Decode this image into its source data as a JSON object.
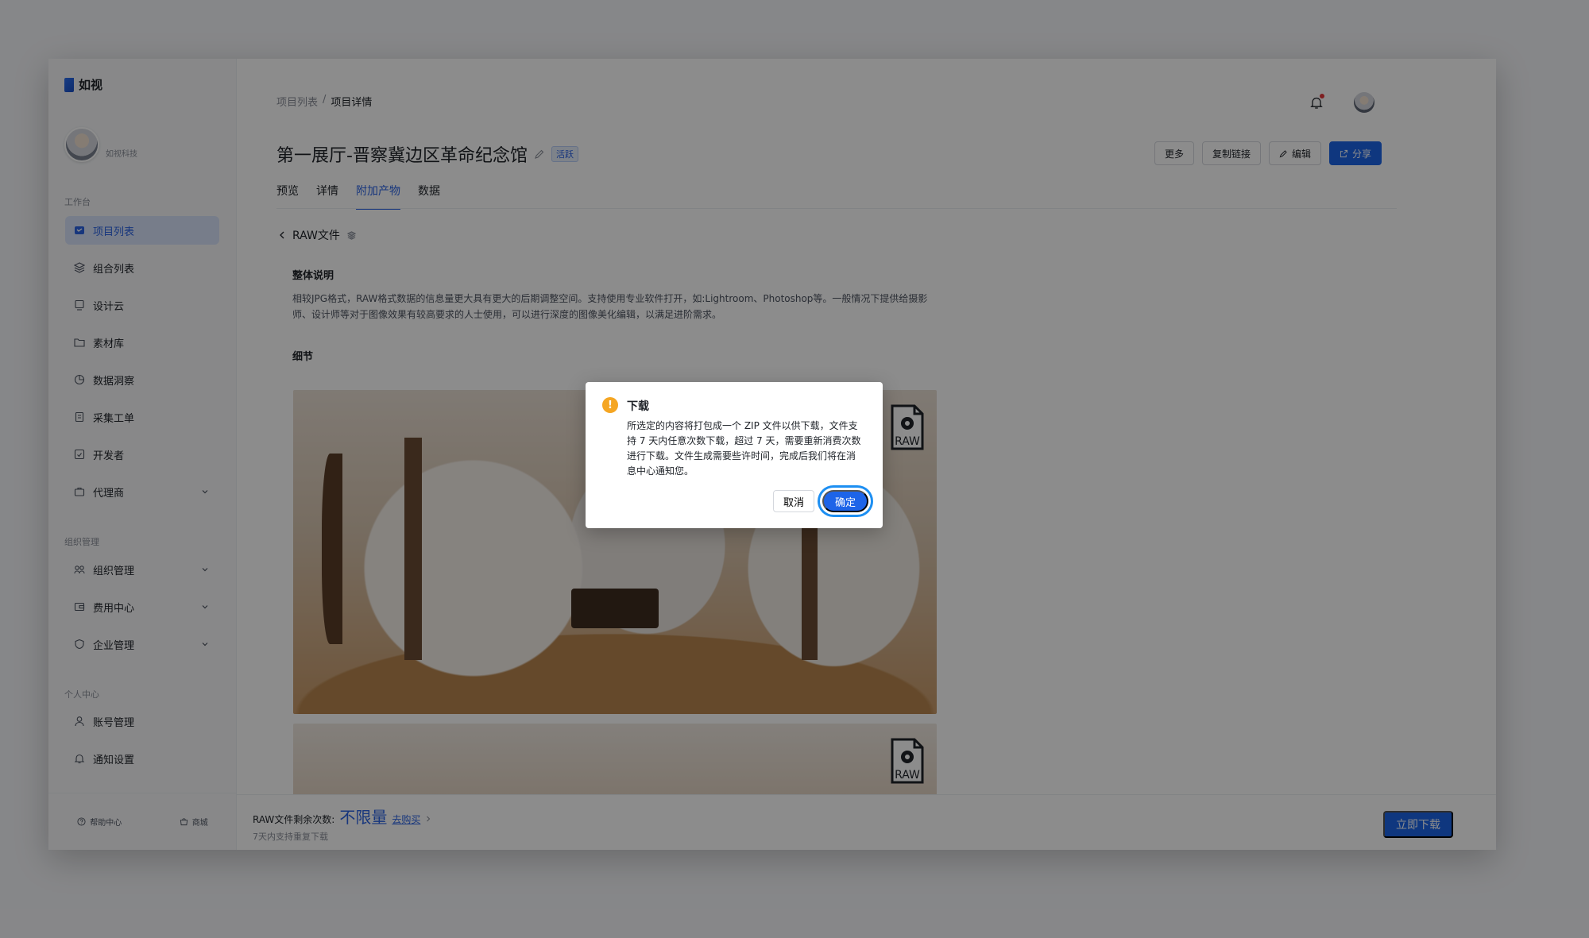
{
  "app": {
    "name": "如视",
    "user_name": "如视科技"
  },
  "sidebar": {
    "section_workbench": "工作台",
    "section_org": "组织管理",
    "section_personal": "个人中心",
    "workbench_items": [
      {
        "label": "项目列表",
        "icon": "projects-icon"
      },
      {
        "label": "组合列表",
        "icon": "layers-icon"
      },
      {
        "label": "设计云",
        "icon": "design-icon"
      },
      {
        "label": "素材库",
        "icon": "folder-icon"
      },
      {
        "label": "数据洞察",
        "icon": "chart-icon"
      },
      {
        "label": "采集工单",
        "icon": "ticket-icon"
      },
      {
        "label": "开发者",
        "icon": "code-icon"
      },
      {
        "label": "代理商",
        "icon": "briefcase-icon"
      }
    ],
    "org_items": [
      {
        "label": "组织管理",
        "icon": "org-icon"
      },
      {
        "label": "费用中心",
        "icon": "wallet-icon"
      },
      {
        "label": "企业管理",
        "icon": "shield-icon"
      }
    ],
    "personal_items": [
      {
        "label": "账号管理",
        "icon": "user-icon"
      },
      {
        "label": "通知设置",
        "icon": "bell-icon"
      }
    ],
    "footer": {
      "help": "帮助中心",
      "store": "商城"
    }
  },
  "header": {
    "breadcrumb": [
      "项目列表",
      "/",
      "项目详情"
    ],
    "title": "第一展厅-晋察冀边区革命纪念馆",
    "tag": "活跃",
    "actions": {
      "more": "更多",
      "copy_link": "复制链接",
      "edit": "编辑",
      "share": "分享"
    }
  },
  "tabs": [
    "预览",
    "详情",
    "附加产物",
    "数据"
  ],
  "content": {
    "back_label": "RAW文件",
    "overall_heading": "整体说明",
    "overall_text": "相较JPG格式，RAW格式数据的信息量更大具有更大的后期调整空间。支持使用专业软件打开，如:Lightroom、Photoshop等。一般情况下提供给摄影师、设计师等对于图像效果有较高要求的人士使用，可以进行深度的图像美化编辑，以满足进阶需求。",
    "detail_heading": "细节",
    "raw_badge": "RAW"
  },
  "bottom_bar": {
    "remaining_label": "RAW文件剩余次数:",
    "remaining_value": "不限量",
    "buy_link": "去购买",
    "note": "7天内支持重复下载",
    "download_button": "立即下载"
  },
  "dialog": {
    "title": "下载",
    "body": "所选定的内容将打包成一个 ZIP 文件以供下载，文件支持 7 天内任意次数下载，超过 7 天，需要重新消费次数进行下载。文件生成需要些许时间，完成后我们将在消息中心通知您。",
    "cancel": "取消",
    "ok": "确定"
  },
  "colors": {
    "primary": "#1d64e8",
    "warning": "#f5a623",
    "notification_dot": "#e5383b"
  }
}
